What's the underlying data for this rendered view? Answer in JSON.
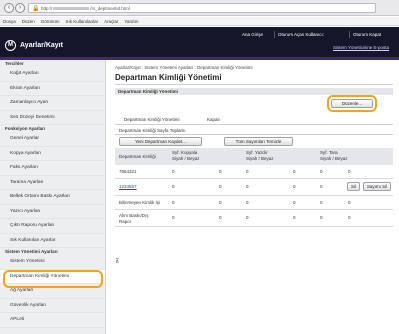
{
  "browser": {
    "back_glyph": "‹",
    "forward_glyph": "›",
    "lock_glyph": "🔒",
    "url_prefix": "http://",
    "url_suffix": "/rs_deptmentid.html"
  },
  "menubar": {
    "items": [
      "Dosya",
      "Düzen",
      "Görünüm",
      "Sık Kullanılanlar",
      "Araçlar",
      "Yardım"
    ]
  },
  "header": {
    "logo_glyph": "M",
    "title": "Ayarlar/Kayıt",
    "links": [
      "Ana Girişe",
      "Oturum Açan Kullanıcı:",
      "Oturum Kapat"
    ],
    "portal_link": "Sistem Yöneticisine E-posta",
    "colors": {
      "bg": "#15162a",
      "accent": "#3f2a73"
    }
  },
  "sidebar": {
    "sections": [
      {
        "heading": "Tercihler",
        "items": [
          "Kağıt Ayarları",
          "Ekran Ayarları",
          "Zamanlayıcı Ayarı",
          "Ses Düzeyi Denetimi"
        ]
      },
      {
        "heading": "Fonksiyon Ayarları",
        "items": [
          "Genel Ayarlar",
          "Kopya Ayarları",
          "Faks Ayarları",
          "Tarama Ayarları",
          "Bellek Ortamı Baskı Ayarları",
          "Yazıcı Ayarları",
          "Çıktı Raporu Ayarları",
          "Sık Kullanılan Ayarlar"
        ]
      },
      {
        "heading": "Sistem Yönetimi Ayarları",
        "items": [
          "Sistem Yönetimi",
          "Departman Kimliği Yönetimi",
          "Ağ Ayarları",
          "Güvenlik Ayarları",
          "APLeti"
        ]
      }
    ],
    "selected": "Departman Kimliği Yönetimi",
    "highlight_color": "#f2a41c"
  },
  "main": {
    "breadcrumb": "Ayarlar/Kayıt : Sistem Yönetimi Ayarları : Departman Kimliği Yönetimi",
    "title": "Departman Kimliği Yönetimi",
    "section_title": "Departman Kimliği Yönetimi",
    "settings_button": "Düzenle...",
    "status_label": "Departman Kimliği Yönetimi",
    "status_value": "Kapalı",
    "page_totals_label": "Departman Kimliği Sayfa Toplamı",
    "register_button": "Yeni Departman Kaydet...",
    "clear_all_button": "Tüm Sayımları Temizle",
    "table": {
      "col_id": "Departman Kimliği",
      "groups": [
        {
          "name": "Syf. Kopyala",
          "sub": "Siyah / Beyaz"
        },
        {
          "name": "Syf. Yazdır",
          "sub": "Siyah / Beyaz"
        },
        {
          "name": "Syf. Tara",
          "sub": "Siyah / Beyaz"
        }
      ],
      "rows": [
        {
          "id": "7654321",
          "link": false,
          "copy": "0",
          "print": "0",
          "scan": "0",
          "c1": "0",
          "c2": "0",
          "c3": "0",
          "actions": false
        },
        {
          "id": "1234567",
          "link": true,
          "copy": "0",
          "print": "0",
          "scan": "0",
          "c1": "0",
          "c2": "0",
          "c3": "0",
          "actions": true
        },
        {
          "id": "Bilinmeyen Kimlik İşi",
          "link": false,
          "copy": "0",
          "print": "0",
          "scan": "0",
          "c1": "0",
          "c2": "0",
          "c3": "0",
          "actions": false
        },
        {
          "id": "Alım Baskı/Dış Rapor",
          "link": false,
          "copy": "0",
          "print": "0",
          "scan": "0",
          "c1": "0",
          "c2": "0",
          "c3": "0",
          "actions": false
        }
      ],
      "delete_button": "Sil",
      "clear_count_button": "Sayımı Sil"
    },
    "scroll_up_glyph": "⊼"
  }
}
